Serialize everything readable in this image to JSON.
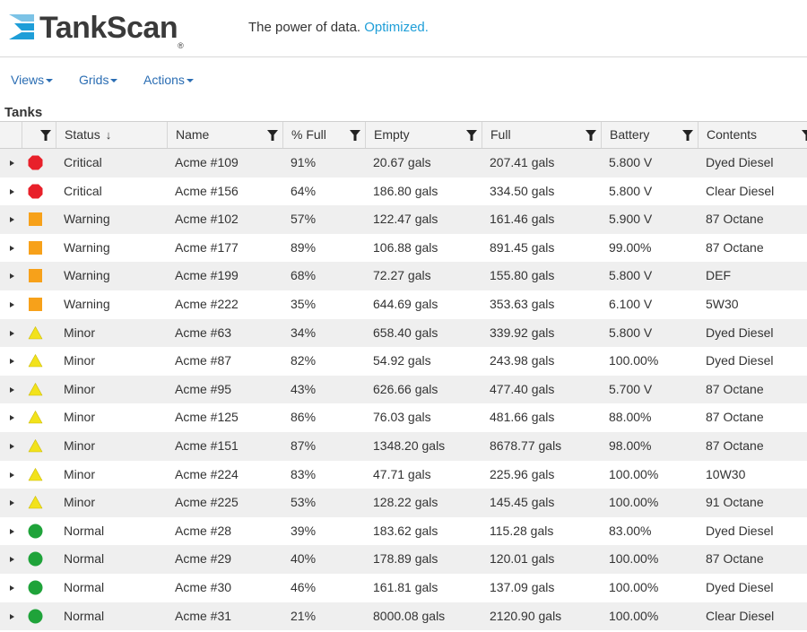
{
  "header": {
    "app_name": "TankScan",
    "trademark": "®",
    "tagline_main": "The power of data.",
    "tagline_accent": "Optimized."
  },
  "menu": [
    {
      "label": "Views"
    },
    {
      "label": "Grids"
    },
    {
      "label": "Actions"
    }
  ],
  "section_title": "Tanks",
  "columns": [
    {
      "label": "Status"
    },
    {
      "label": "Name"
    },
    {
      "label": "% Full"
    },
    {
      "label": "Empty"
    },
    {
      "label": "Full"
    },
    {
      "label": "Battery"
    },
    {
      "label": "Contents"
    }
  ],
  "sort": {
    "column": "Status",
    "direction": "descending"
  },
  "status_icons": {
    "Critical": {
      "icon": "stop-octagon-icon",
      "color": "#e8202a"
    },
    "Warning": {
      "icon": "warning-square-icon",
      "color": "#f7a11a"
    },
    "Minor": {
      "icon": "minor-triangle-icon",
      "color": "#f2e21c"
    },
    "Normal": {
      "icon": "normal-circle-icon",
      "color": "#1fa33a"
    }
  },
  "rows": [
    {
      "status": "Critical",
      "name": "Acme #109",
      "pct_full": "91%",
      "empty": "20.67 gals",
      "full": "207.41 gals",
      "battery": "5.800 V",
      "contents": "Dyed Diesel"
    },
    {
      "status": "Critical",
      "name": "Acme #156",
      "pct_full": "64%",
      "empty": "186.80 gals",
      "full": "334.50 gals",
      "battery": "5.800 V",
      "contents": "Clear Diesel"
    },
    {
      "status": "Warning",
      "name": "Acme #102",
      "pct_full": "57%",
      "empty": "122.47 gals",
      "full": "161.46 gals",
      "battery": "5.900 V",
      "contents": "87 Octane"
    },
    {
      "status": "Warning",
      "name": "Acme #177",
      "pct_full": "89%",
      "empty": "106.88 gals",
      "full": "891.45 gals",
      "battery": "99.00%",
      "contents": "87 Octane"
    },
    {
      "status": "Warning",
      "name": "Acme #199",
      "pct_full": "68%",
      "empty": "72.27 gals",
      "full": "155.80 gals",
      "battery": "5.800 V",
      "contents": "DEF"
    },
    {
      "status": "Warning",
      "name": "Acme #222",
      "pct_full": "35%",
      "empty": "644.69 gals",
      "full": "353.63 gals",
      "battery": "6.100 V",
      "contents": "5W30"
    },
    {
      "status": "Minor",
      "name": "Acme #63",
      "pct_full": "34%",
      "empty": "658.40 gals",
      "full": "339.92 gals",
      "battery": "5.800 V",
      "contents": "Dyed Diesel"
    },
    {
      "status": "Minor",
      "name": "Acme #87",
      "pct_full": "82%",
      "empty": "54.92 gals",
      "full": "243.98 gals",
      "battery": "100.00%",
      "contents": "Dyed Diesel"
    },
    {
      "status": "Minor",
      "name": "Acme #95",
      "pct_full": "43%",
      "empty": "626.66 gals",
      "full": "477.40 gals",
      "battery": "5.700 V",
      "contents": "87 Octane"
    },
    {
      "status": "Minor",
      "name": "Acme #125",
      "pct_full": "86%",
      "empty": "76.03 gals",
      "full": "481.66 gals",
      "battery": "88.00%",
      "contents": "87 Octane"
    },
    {
      "status": "Minor",
      "name": "Acme #151",
      "pct_full": "87%",
      "empty": "1348.20 gals",
      "full": "8678.77 gals",
      "battery": "98.00%",
      "contents": "87 Octane"
    },
    {
      "status": "Minor",
      "name": "Acme #224",
      "pct_full": "83%",
      "empty": "47.71 gals",
      "full": "225.96 gals",
      "battery": "100.00%",
      "contents": "10W30"
    },
    {
      "status": "Minor",
      "name": "Acme #225",
      "pct_full": "53%",
      "empty": "128.22 gals",
      "full": "145.45 gals",
      "battery": "100.00%",
      "contents": "91 Octane"
    },
    {
      "status": "Normal",
      "name": "Acme #28",
      "pct_full": "39%",
      "empty": "183.62 gals",
      "full": "115.28 gals",
      "battery": "83.00%",
      "contents": "Dyed Diesel"
    },
    {
      "status": "Normal",
      "name": "Acme #29",
      "pct_full": "40%",
      "empty": "178.89 gals",
      "full": "120.01 gals",
      "battery": "100.00%",
      "contents": "87 Octane"
    },
    {
      "status": "Normal",
      "name": "Acme #30",
      "pct_full": "46%",
      "empty": "161.81 gals",
      "full": "137.09 gals",
      "battery": "100.00%",
      "contents": "Dyed Diesel"
    },
    {
      "status": "Normal",
      "name": "Acme #31",
      "pct_full": "21%",
      "empty": "8000.08 gals",
      "full": "2120.90 gals",
      "battery": "100.00%",
      "contents": "Clear Diesel"
    }
  ]
}
